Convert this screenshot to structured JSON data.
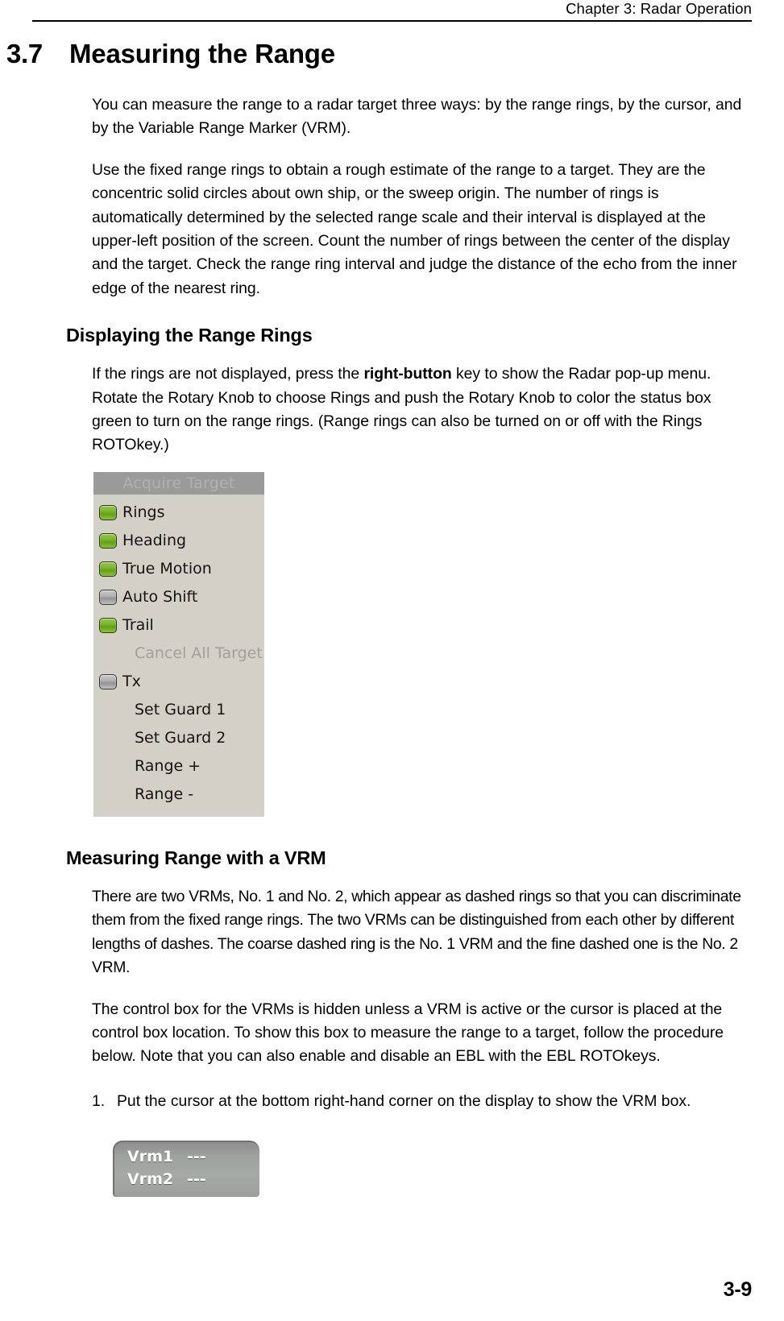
{
  "header": {
    "chapter": "Chapter 3: Radar Operation"
  },
  "section": {
    "number": "3.7",
    "title": "Measuring the Range"
  },
  "intro": {
    "p1": "You can measure the range to a radar target three ways: by the range rings, by the cursor, and by the Variable Range Marker (VRM).",
    "p2": "Use the fixed range rings to obtain a rough estimate of the range to a target. They are the concentric solid circles about own ship, or the sweep origin. The number of rings is automatically determined by the selected range scale and their interval is displayed at the upper-left position of the screen. Count the number of rings between the center of the display and the target. Check the range ring interval and judge the distance of the echo from the inner edge of the nearest ring."
  },
  "subsection_rings": {
    "heading": "Displaying the Range Rings",
    "p1_part1": "If the rings are not displayed, press the ",
    "p1_bold": "right-button",
    "p1_part2": " key to show the Radar pop-up menu. Rotate the Rotary Knob to choose Rings and push the Rotary Knob to color the status box green to turn on the range rings. (Range rings can also be turned on or off with the Rings ROTOkey.)"
  },
  "popup_menu": {
    "title": "Acquire Target",
    "items": [
      {
        "label": "Rings",
        "box": "on"
      },
      {
        "label": "Heading",
        "box": "on"
      },
      {
        "label": "True Motion",
        "box": "on"
      },
      {
        "label": "Auto Shift",
        "box": "off"
      },
      {
        "label": "Trail",
        "box": "on"
      },
      {
        "label": "Cancel All Target",
        "box": "none",
        "disabled": true
      },
      {
        "label": "Tx",
        "box": "off"
      },
      {
        "label": "Set Guard 1",
        "box": "none"
      },
      {
        "label": "Set Guard 2",
        "box": "none"
      },
      {
        "label": "Range +",
        "box": "none"
      },
      {
        "label": "Range -",
        "box": "none"
      }
    ]
  },
  "subsection_vrm": {
    "heading": "Measuring Range with a VRM",
    "p1": "There are two VRMs, No. 1 and No. 2, which appear as dashed rings so that you can discriminate them from the fixed range rings. The two VRMs can be distinguished from each other by different lengths of dashes. The coarse dashed ring is the No. 1 VRM and the fine dashed one is the No. 2 VRM.",
    "p2": "The control box for the VRMs is hidden unless a VRM is active or the cursor is placed at the control box location. To show this box to measure the range to a target, follow the procedure below. Note that you can also enable and disable an EBL with the EBL ROTOkeys.",
    "step1_num": "1.",
    "step1_text": "Put the cursor at the bottom right-hand corner on the display to show the VRM box."
  },
  "vrm_box": {
    "rows": [
      {
        "name": "Vrm1",
        "value": "---"
      },
      {
        "name": "Vrm2",
        "value": "---"
      }
    ]
  },
  "footer": {
    "page": "3-9"
  }
}
